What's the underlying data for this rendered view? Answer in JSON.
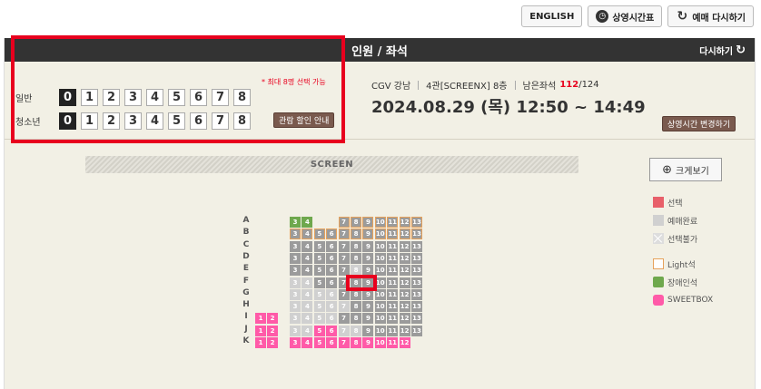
{
  "top_buttons": {
    "english": "ENGLISH",
    "schedule": "상영시간표",
    "restart": "예매 다시하기"
  },
  "header": {
    "title": "인원 / 좌석",
    "reset": "다시하기"
  },
  "people": {
    "max_note": "* 최대 8명 선택 가능",
    "rows": [
      {
        "label": "일반",
        "numbers": [
          "0",
          "1",
          "2",
          "3",
          "4",
          "5",
          "6",
          "7",
          "8"
        ],
        "selected": "0"
      },
      {
        "label": "청소년",
        "numbers": [
          "0",
          "1",
          "2",
          "3",
          "4",
          "5",
          "6",
          "7",
          "8"
        ],
        "selected": "0"
      }
    ],
    "discount_button": "관람 할인 안내"
  },
  "movie": {
    "theater": "CGV 강남",
    "screen": "4관[SCREENX] 8층",
    "remaining_label": "남은좌석",
    "remaining": "112",
    "total": "/124",
    "datetime": "2024.08.29 (목) 12:50 ~ 14:49",
    "change_button": "상영시간 변경하기"
  },
  "screen_label": "SCREEN",
  "zoom_button": "크게보기",
  "legend": [
    {
      "key": "selected",
      "label": "선택"
    },
    {
      "key": "soldout",
      "label": "예매완료"
    },
    {
      "key": "na",
      "label": "선택불가"
    },
    {
      "key": "light",
      "label": "Light석"
    },
    {
      "key": "wheel",
      "label": "장애인석"
    },
    {
      "key": "sweet",
      "label": "SWEETBOX"
    }
  ],
  "rows": [
    "A",
    "B",
    "C",
    "D",
    "E",
    "F",
    "G",
    "H",
    "I",
    "J",
    "K"
  ],
  "seat_numbers": [
    "3",
    "4",
    "5",
    "6",
    "7",
    "8",
    "9",
    "10",
    "11",
    "12",
    "13"
  ]
}
